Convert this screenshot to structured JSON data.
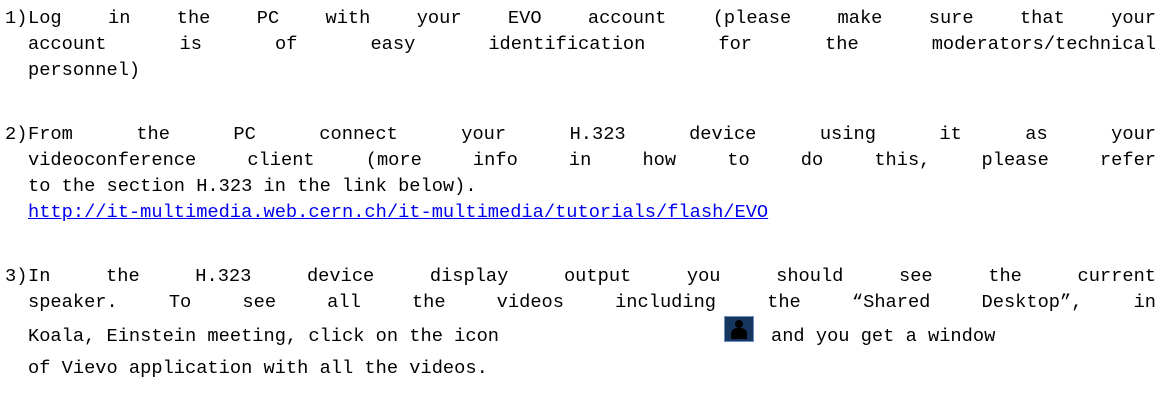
{
  "steps": [
    {
      "number": "1)",
      "lines": [
        "Log in the PC with your EVO account (please make sure that your",
        "account is of easy identification for the moderators/technical",
        "personnel)"
      ]
    },
    {
      "number": "2)",
      "lines": [
        "From the PC connect your H.323 device using it as your",
        "videoconference client (more info in how to do this, please refer",
        "to the section H.323 in the link below)."
      ],
      "link": "http://it-multimedia.web.cern.ch/it-multimedia/tutorials/flash/EVO"
    },
    {
      "number": "3)",
      "lines": [
        " In the H.323 device display output you should see the current",
        "speaker. To see all the videos including the “Shared Desktop”, in"
      ],
      "line3_before_icon": "Koala, Einstein meeting, click on the icon",
      "line3_after_icon": "and you get a window",
      "line4": "of Vievo application with all the videos.",
      "icon": "person-silhouette-icon"
    }
  ]
}
